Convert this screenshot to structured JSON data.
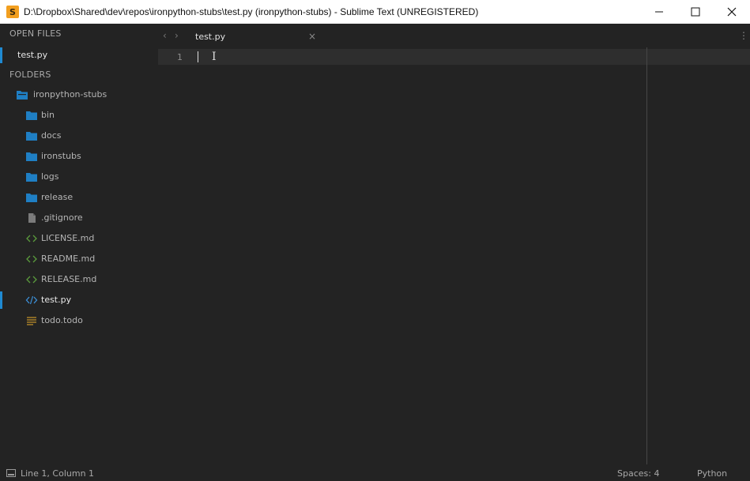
{
  "window": {
    "title": "D:\\Dropbox\\Shared\\dev\\repos\\ironpython-stubs\\test.py (ironpython-stubs) - Sublime Text (UNREGISTERED)",
    "app_icon_glyph": "S",
    "controls": [
      "minimize-icon",
      "maximize-icon",
      "close-icon"
    ]
  },
  "sidebar": {
    "open_files_label": "OPEN FILES",
    "open_files": [
      {
        "name": "test.py",
        "active": true
      }
    ],
    "folders_label": "FOLDERS",
    "tree": [
      {
        "name": "ironpython-stubs",
        "type": "folder-open",
        "depth": 0
      },
      {
        "name": "bin",
        "type": "folder",
        "depth": 1
      },
      {
        "name": "docs",
        "type": "folder",
        "depth": 1
      },
      {
        "name": "ironstubs",
        "type": "folder",
        "depth": 1
      },
      {
        "name": "logs",
        "type": "folder",
        "depth": 1
      },
      {
        "name": "release",
        "type": "folder",
        "depth": 1
      },
      {
        "name": ".gitignore",
        "type": "file",
        "depth": 1
      },
      {
        "name": "LICENSE.md",
        "type": "markup",
        "depth": 1
      },
      {
        "name": "README.md",
        "type": "markup",
        "depth": 1
      },
      {
        "name": "RELEASE.md",
        "type": "markup",
        "depth": 1
      },
      {
        "name": "test.py",
        "type": "code",
        "depth": 1,
        "active": true
      },
      {
        "name": "todo.todo",
        "type": "list",
        "depth": 1
      }
    ]
  },
  "tabs": [
    {
      "label": "test.py",
      "close_glyph": "×"
    }
  ],
  "editor": {
    "line_numbers": [
      "1"
    ],
    "lines": [
      ""
    ]
  },
  "status": {
    "position": "Line 1, Column 1",
    "indent": "Spaces: 4",
    "syntax": "Python"
  },
  "colors": {
    "accent": "#1f8ad2",
    "folder": "#1f7fc4",
    "markup": "#5a9a3c",
    "todo": "#c8962a",
    "background": "#232323"
  }
}
